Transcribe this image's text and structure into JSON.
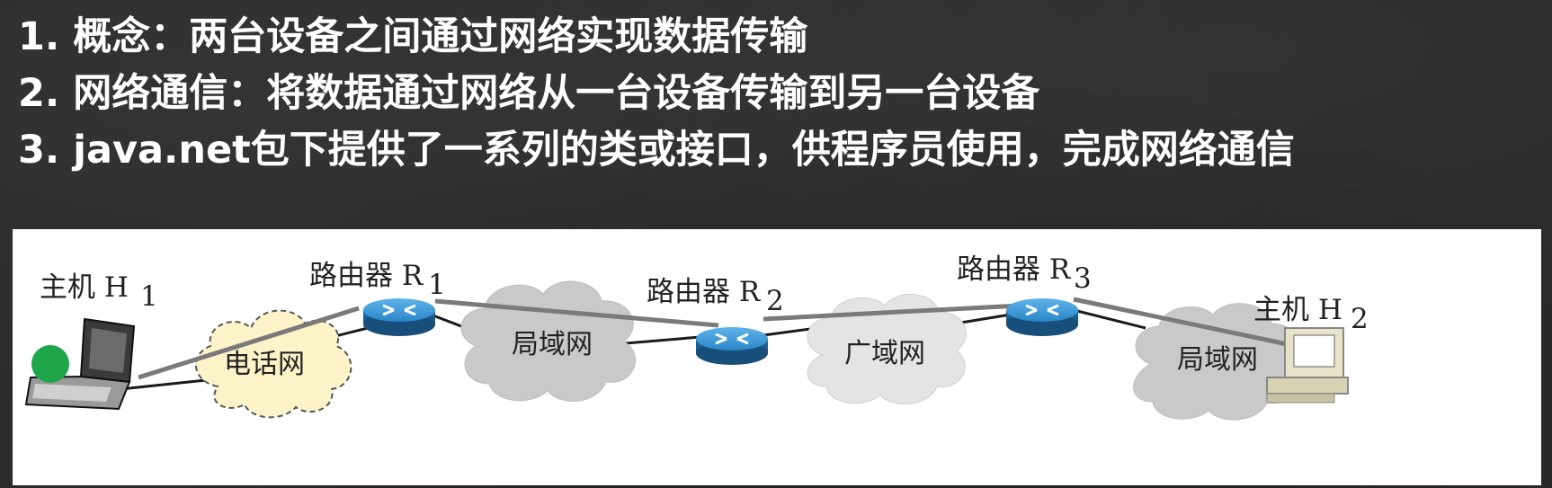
{
  "bullets": [
    "1. 概念：两台设备之间通过网络实现数据传输",
    "2. 网络通信：将数据通过网络从一台设备传输到另一台设备",
    "3. java.net包下提供了一系列的类或接口，供程序员使用，完成网络通信"
  ],
  "diagram": {
    "host1": {
      "label": "主机 H",
      "sub": "1"
    },
    "host2": {
      "label": "主机 H",
      "sub": "2"
    },
    "router1": {
      "label": "路由器 R",
      "sub": "1"
    },
    "router2": {
      "label": "路由器 R",
      "sub": "2"
    },
    "router3": {
      "label": "路由器 R",
      "sub": "3"
    },
    "cloud_phone": "电话网",
    "cloud_lan1": "局域网",
    "cloud_wan": "广域网",
    "cloud_lan2": "局域网"
  },
  "colors": {
    "router_blue": "#2a86c7",
    "arrow_gray": "#7a7a7a",
    "phone_cloud": "#fdf3c8",
    "lan_cloud": "#c9c9c9",
    "wan_cloud": "#e4e4e4",
    "cursor_green": "#1fa64a"
  }
}
